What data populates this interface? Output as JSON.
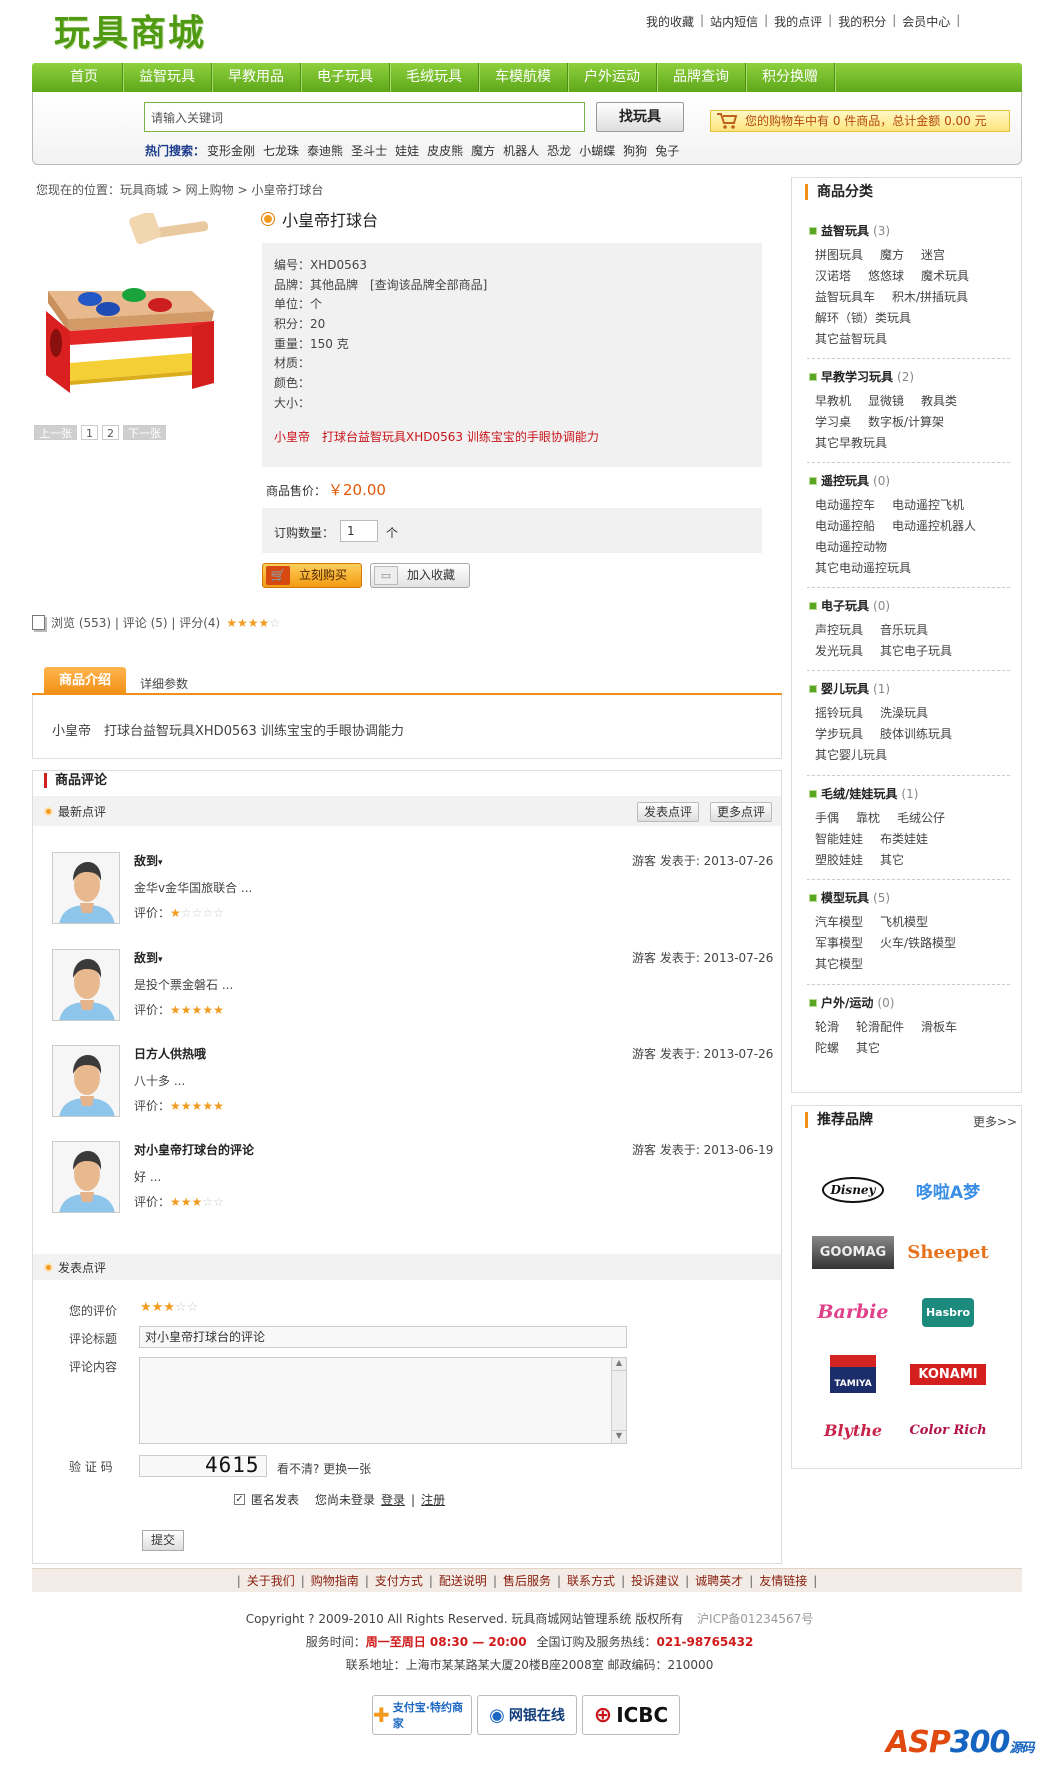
{
  "header": {
    "logo": "玩具商城",
    "links": [
      "我的收藏",
      "站内短信",
      "我的点评",
      "我的积分",
      "会员中心"
    ]
  },
  "nav": [
    "首页",
    "益智玩具",
    "早教用品",
    "电子玩具",
    "毛绒玩具",
    "车模航模",
    "户外运动",
    "品牌查询",
    "积分换赠"
  ],
  "search": {
    "placeholder": "请输入关键词",
    "button": "找玩具",
    "cart": "您的购物车中有 0 件商品，总计金额 0.00 元",
    "hot_label": "热门搜索：",
    "hot": [
      "变形金刚",
      "七龙珠",
      "泰迪熊",
      "圣斗士",
      "娃娃",
      "皮皮熊",
      "魔方",
      "机器人",
      "恐龙",
      "小蝴蝶",
      "狗狗",
      "兔子"
    ]
  },
  "breadcrumb": "您现在的位置：玩具商城 > 网上购物 > 小皇帝打球台",
  "product": {
    "title": "小皇帝打球台",
    "pager": [
      "上一张",
      "1",
      "2",
      "下一张"
    ],
    "info": [
      "编号：XHD0563",
      "品牌：其他品牌　[查询该品牌全部商品]",
      "单位：个",
      "积分：20",
      "重量：150 克",
      "材质：",
      "颜色：",
      "大小："
    ],
    "promo": "小皇帝　打球台益智玩具XHD0563 训练宝宝的手眼协调能力",
    "price_label": "商品售价：",
    "price": "￥20.00",
    "qty_label": "订购数量：",
    "qty": "1",
    "qty_unit": "个",
    "buy": "立刻购买",
    "fav": "加入收藏",
    "stats": "浏览 (553) | 评论 (5) | 评分(4)",
    "rating": 4
  },
  "tabs": {
    "intro": "商品介绍",
    "params": "详细参数",
    "intro_text": "小皇帝　打球台益智玩具XHD0563 训练宝宝的手眼协调能力"
  },
  "reviews": {
    "title": "商品评论",
    "latest": "最新点评",
    "post_btn": "发表点评",
    "more_btn": "更多点评",
    "score_label": "评价：",
    "items": [
      {
        "name": "敌到",
        "date": "游客  发表于: 2013-07-26",
        "body": "金华v金华国旅联合 ...",
        "score": 1
      },
      {
        "name": "敌到",
        "date": "游客  发表于: 2013-07-26",
        "body": "是投个票金磐石 ...",
        "score": 5
      },
      {
        "name": "日方人供热哦",
        "date": "游客  发表于: 2013-07-26",
        "body": "八十多 ...",
        "score": 5
      },
      {
        "name": "对小皇帝打球台的评论",
        "date": "游客  发表于: 2013-06-19",
        "body": "好 ...",
        "score": 3
      }
    ]
  },
  "form": {
    "title": "发表点评",
    "rate_label": "您的评价",
    "rate": 3,
    "subject_label": "评论标题",
    "subject": "对小皇帝打球台的评论",
    "content_label": "评论内容",
    "code_label": "验 证 码",
    "captcha": "4615",
    "refresh": "看不清? 更换一张",
    "anon": "匿名发表",
    "login_prompt": "您尚未登录",
    "login": "登录",
    "register": "注册",
    "submit": "提交"
  },
  "sidebar": {
    "cat_title": "商品分类",
    "cats": [
      {
        "name": "益智玩具",
        "count": "(3)",
        "items": [
          "拼图玩具",
          "魔方",
          "迷宫",
          "汉诺塔",
          "悠悠球",
          "魔术玩具",
          "益智玩具车",
          "积木/拼插玩具",
          "解环（锁）类玩具",
          "其它益智玩具"
        ]
      },
      {
        "name": "早教学习玩具",
        "count": "(2)",
        "items": [
          "早教机",
          "显微镜",
          "教具类",
          "学习桌",
          "数字板/计算架",
          "其它早教玩具"
        ]
      },
      {
        "name": "遥控玩具",
        "count": "(0)",
        "items": [
          "电动遥控车",
          "电动遥控飞机",
          "电动遥控船",
          "电动遥控机器人",
          "电动遥控动物",
          "其它电动遥控玩具"
        ]
      },
      {
        "name": "电子玩具",
        "count": "(0)",
        "items": [
          "声控玩具",
          "音乐玩具",
          "发光玩具",
          "其它电子玩具"
        ]
      },
      {
        "name": "婴儿玩具",
        "count": "(1)",
        "items": [
          "摇铃玩具",
          "洗澡玩具",
          "学步玩具",
          "肢体训练玩具",
          "其它婴儿玩具"
        ]
      },
      {
        "name": "毛绒/娃娃玩具",
        "count": "(1)",
        "items": [
          "手偶",
          "靠枕",
          "毛绒公仔",
          "智能娃娃",
          "布类娃娃",
          "塑胶娃娃",
          "其它"
        ]
      },
      {
        "name": "模型玩具",
        "count": "(5)",
        "items": [
          "汽车模型",
          "飞机模型",
          "军事模型",
          "火车/铁路模型",
          "其它模型"
        ]
      },
      {
        "name": "户外/运动",
        "count": "(0)",
        "items": [
          "轮滑",
          "轮滑配件",
          "滑板车",
          "陀螺",
          "其它"
        ]
      }
    ],
    "brand_title": "推荐品牌",
    "brand_more": "更多>>",
    "brands": [
      "Disney",
      "哆啦A梦",
      "GOOMAG",
      "Sheepet",
      "Barbie",
      "Hasbro",
      "TAMIYA",
      "KONAMI",
      "Blythe",
      "Color Rich"
    ]
  },
  "footer": {
    "links": [
      "关于我们",
      "购物指南",
      "支付方式",
      "配送说明",
      "售后服务",
      "联系方式",
      "投诉建议",
      "诚聘英才",
      "友情链接"
    ],
    "copyright": "Copyright ? 2009-2010 All Rights Reserved. 玩具商城网站管理系统  版权所有",
    "icp": "沪ICP备01234567号",
    "hours_label": "服务时间：",
    "hours": "周一至周日  08:30 — 20:00",
    "hotline_label": "全国订购及服务热线：",
    "hotline": "021-98765432",
    "address": "联系地址：上海市某某路某大厦20楼B座2008室   邮政编码：210000",
    "pay": [
      "支付宝·特约商家",
      "网银在线",
      "ICBC"
    ],
    "watermark_a": "ASP",
    "watermark_b": "300",
    "watermark_c": "源码"
  }
}
